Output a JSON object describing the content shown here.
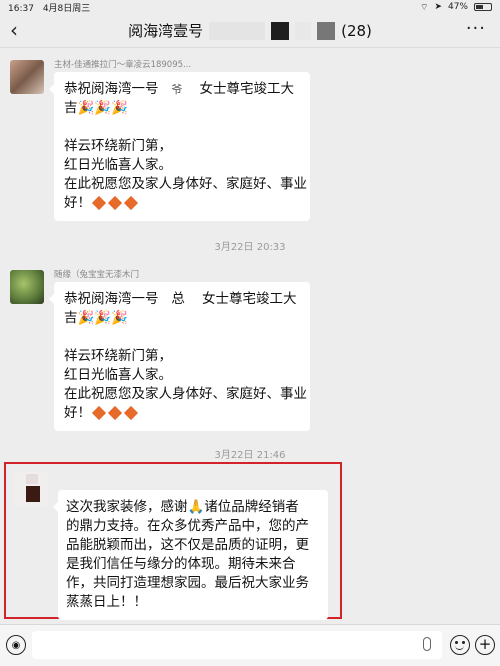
{
  "status_bar": {
    "time": "16:37",
    "date": "4月8日周三",
    "battery": "47%"
  },
  "header": {
    "title": "阅海湾壹号",
    "member_count": "(28)",
    "back_icon": "chevron-left-icon",
    "more_icon": "more-dots-icon"
  },
  "messages": [
    {
      "sender": "主材-佳通推拉门～章凌云189095...",
      "lines": [
        "恭祝阅海湾一号",
        "女士尊宅竣工大",
        "吉🎉🎉🎉",
        "",
        "祥云环绕新门第，",
        "红日光临喜人家。",
        "在此祝愿您及家人身体好、家庭好、事业",
        "好！"
      ],
      "name_glyph": "爷"
    },
    {
      "timestamp": "3月22日 20:33"
    },
    {
      "sender": "随缘（兔宝宝无漆木门",
      "lines": [
        "恭祝阅海湾一号",
        "女士尊宅竣工大",
        "吉🎉🎉🎉",
        "",
        "祥云环绕新门第，",
        "红日光临喜人家。",
        "在此祝愿您及家人身体好、家庭好、事业",
        "好！"
      ],
      "name_glyph": "总"
    },
    {
      "timestamp": "3月22日 21:46"
    },
    {
      "lines": [
        "这次我家装修，感谢🙏诸位品牌经销者",
        "的鼎力支持。在众多优秀产品中，您的产",
        "品能脱颖而出，这不仅是品质的证明，更",
        "是我们信任与缘分的体现。期待未来合",
        "作，共同打造理想家园。最后祝大家业务",
        "蒸蒸日上！！"
      ]
    }
  ],
  "colors": {
    "highlight_border": "#d2232a",
    "diamond": "#e66a2a"
  }
}
